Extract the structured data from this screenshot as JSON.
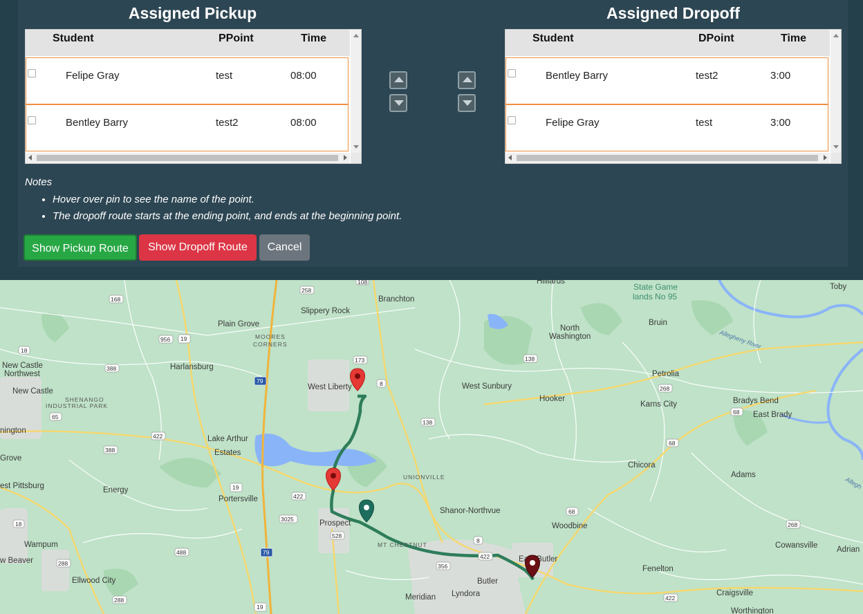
{
  "pickup": {
    "title": "Assigned Pickup",
    "columns": [
      "Student",
      "PPoint",
      "Time"
    ],
    "rows": [
      {
        "student": "Felipe Gray",
        "point": "test",
        "time": "08:00"
      },
      {
        "student": "Bentley Barry",
        "point": "test2",
        "time": "08:00"
      }
    ]
  },
  "dropoff": {
    "title": "Assigned Dropoff",
    "columns": [
      "Student",
      "DPoint",
      "Time"
    ],
    "rows": [
      {
        "student": "Bentley Barry",
        "point": "test2",
        "time": "3:00"
      },
      {
        "student": "Felipe Gray",
        "point": "test",
        "time": "3:00"
      }
    ]
  },
  "notes": {
    "title": "Notes",
    "items": [
      "Hover over pin to see the name of the point.",
      "The dropoff route starts at the ending point, and ends at the beginning point."
    ]
  },
  "buttons": {
    "pickup_route": "Show Pickup Route",
    "dropoff_route": "Show Dropoff Route",
    "cancel": "Cancel"
  },
  "colors": {
    "panel": "#2d4653",
    "pickup_button": "#28a745",
    "dropoff_button": "#dc3545",
    "cancel_button": "#6c757d",
    "row_border": "#ef8f3f",
    "route": "#2e7d5b",
    "pin_red": "#e53935",
    "pin_teal": "#1e6e5e",
    "pin_dark": "#6b0f16"
  },
  "map": {
    "places": {
      "hilliards": "Hilliards",
      "toby": "Toby",
      "state_game": "State Game",
      "lands_no_95": "lands No 95",
      "branchton": "Branchton",
      "slippery_rock": "Slippery Rock",
      "plain_grove": "Plain Grove",
      "bruin": "Bruin",
      "north": "North",
      "washington": "Washington",
      "moores": "MOORES",
      "corners": "CORNERS",
      "harlansburg": "Harlansburg",
      "new_castle_nw1": "New Castle",
      "new_castle_nw2": "Northwest",
      "new_castle": "New Castle",
      "shenango1": "SHENANGO",
      "shenango2": "INDUSTRIAL PARK",
      "west_liberty": "West Liberty",
      "west_sunbury": "West Sunbury",
      "hooker": "Hooker",
      "petrolia": "Petrolia",
      "karns_city": "Karns City",
      "bradys_bend": "Bradys Bend",
      "east_brady": "East Brady",
      "allegheny": "Allegheny River",
      "nington": "nington",
      "lake_arthur1": "Lake Arthur",
      "lake_arthur2": "Estates",
      "grove": "Grove",
      "chicora": "Chicora",
      "adams": "Adams",
      "unionville": "UNIONVILLE",
      "east_pittsburg": "est Pittsburg",
      "energy": "Energy",
      "portersville": "Portersville",
      "shanor": "Shanor-Northvue",
      "prospect": "Prospect",
      "woodbine": "Woodbine",
      "mt_chestnut": "MT CHESTNUT",
      "wampum": "Wampum",
      "east_butler": "East Butler",
      "cowansville": "Cowansville",
      "adrian": "Adrian",
      "w_beaver": "w Beaver",
      "ellwood": "Ellwood City",
      "butler": "Butler",
      "fenelton": "Fenelton",
      "meridian": "Meridian",
      "lyndora": "Lyndora",
      "craigsville": "Craigsville",
      "worthington": "Worthington",
      "alleghe": "Allegh"
    },
    "route_shields": [
      "108",
      "168",
      "258",
      "956",
      "19",
      "18",
      "388",
      "173",
      "8",
      "138",
      "268",
      "68",
      "422",
      "65",
      "79",
      "138",
      "388",
      "68",
      "19",
      "422",
      "3025",
      "528",
      "68",
      "8",
      "422",
      "356",
      "18",
      "488",
      "288",
      "79",
      "268",
      "422",
      "288",
      "19"
    ]
  }
}
